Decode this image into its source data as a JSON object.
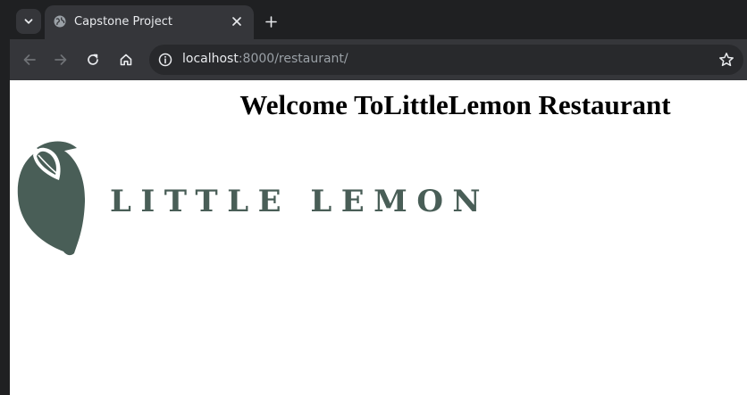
{
  "browser": {
    "tab": {
      "title": "Capstone Project"
    },
    "address_bar": {
      "host": "localhost",
      "path": ":8000/restaurant/"
    }
  },
  "page": {
    "heading": "Welcome ToLittleLemon Restaurant",
    "logo": {
      "text": "LITTLE LEMON",
      "color": "#495e57"
    }
  },
  "colors": {
    "chrome_dark": "#1f2022",
    "chrome_toolbar": "#35363a",
    "omnibox_bg": "#28292c",
    "icon_light": "#e8eaed",
    "icon_muted": "#9aa0a6"
  }
}
